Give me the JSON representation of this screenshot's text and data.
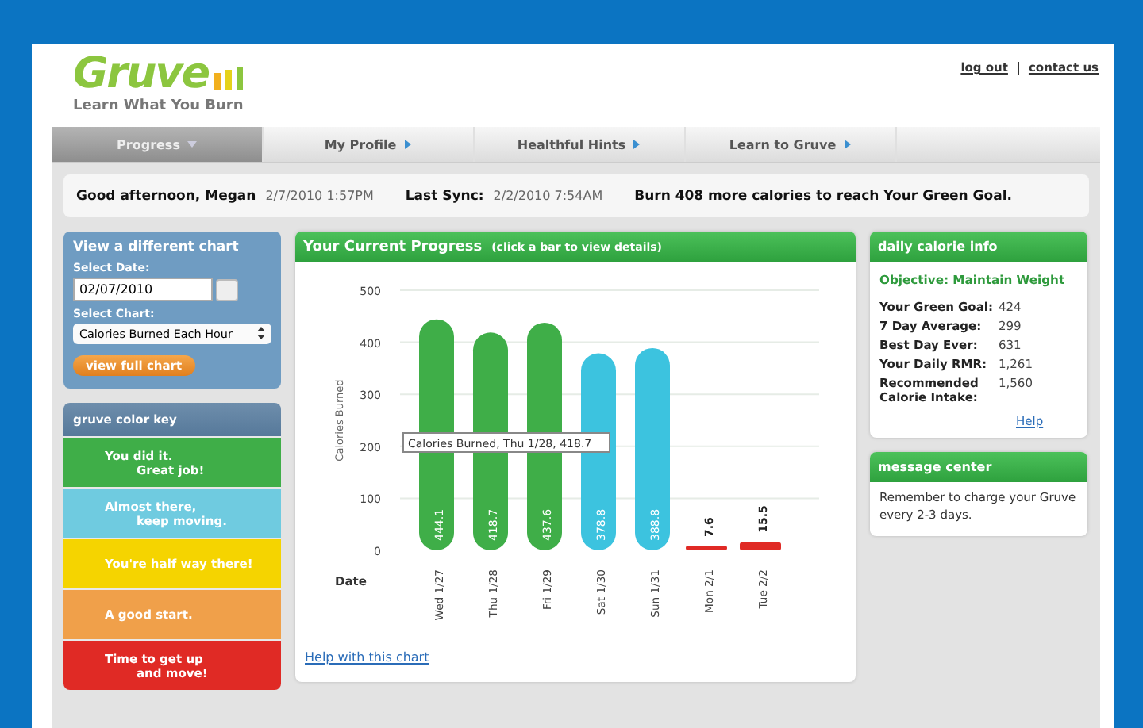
{
  "header": {
    "logo": "Gruve",
    "tagline": "Learn What You Burn",
    "links": [
      "log out",
      "contact us"
    ]
  },
  "nav": [
    {
      "label": "Progress",
      "selected": true
    },
    {
      "label": "My Profile",
      "selected": false
    },
    {
      "label": "Healthful Hints",
      "selected": false
    },
    {
      "label": "Learn to Gruve",
      "selected": false
    }
  ],
  "greeting": {
    "text": "Good afternoon, Megan",
    "datetime": "2/7/2010 1:57PM",
    "sync_label": "Last Sync:",
    "sync_time": "2/2/2010 7:54AM",
    "goal_message": "Burn 408 more calories to reach Your Green Goal."
  },
  "chart_picker": {
    "title": "View a different chart",
    "date_label": "Select Date:",
    "date_value": "02/07/2010",
    "chart_label": "Select Chart:",
    "chart_value": "Calories Burned Each Hour",
    "button": "view full chart"
  },
  "color_key": {
    "title": "gruve color key",
    "items": [
      {
        "lines": [
          "You did it.",
          "Great job!"
        ],
        "color": "#3fae48"
      },
      {
        "lines": [
          "Almost there,",
          "keep moving."
        ],
        "color": "#6fcbe0"
      },
      {
        "lines": [
          "You're half way there!"
        ],
        "color": "#f5d400"
      },
      {
        "lines": [
          "A good start."
        ],
        "color": "#f0a04a"
      },
      {
        "lines": [
          "Time to get up",
          "and move!"
        ],
        "color": "#e02a25"
      }
    ]
  },
  "progress": {
    "title": "Your Current Progress",
    "hint": "(click a bar to view details)",
    "help_link": "Help with this chart",
    "chart_data": {
      "type": "bar",
      "xlabel": "Date",
      "ylabel": "Calories Burned",
      "categories": [
        "Wed 1/27",
        "Thu 1/28",
        "Fri 1/29",
        "Sat 1/30",
        "Sun 1/31",
        "Mon 2/1",
        "Tue 2/2"
      ],
      "series": [
        {
          "color": "#3fae48",
          "values": [
            444.1,
            418.7,
            437.6,
            null,
            null,
            null,
            null
          ]
        },
        {
          "color": "#3cc3df",
          "values": [
            null,
            null,
            null,
            378.8,
            388.8,
            null,
            null
          ]
        },
        {
          "color": "#e02a25",
          "values": [
            null,
            null,
            null,
            null,
            null,
            7.6,
            15.5
          ]
        }
      ],
      "stacked": true,
      "grid": true,
      "ylim": [
        0,
        500
      ],
      "yticks": [
        0,
        100,
        200,
        300,
        400,
        500
      ],
      "value_labels": [
        "444.1",
        "418.7",
        "437.6",
        "378.8",
        "388.8",
        "7.6",
        "15.5"
      ],
      "annotations": [
        {
          "text": "Calories Burned, Thu 1/28, 418.7"
        }
      ]
    }
  },
  "calorie_info": {
    "title": "daily calorie info",
    "objective": "Objective: Maintain Weight",
    "rows": [
      {
        "label": "Your Green Goal:",
        "value": "424"
      },
      {
        "label": "7 Day Average:",
        "value": "299"
      },
      {
        "label": "Best Day Ever:",
        "value": "631"
      },
      {
        "label": "Your Daily RMR:",
        "value": "1,261"
      },
      {
        "label": "Recommended Calorie Intake:",
        "value": "1,560"
      }
    ],
    "help": "Help"
  },
  "message_center": {
    "title": "message center",
    "message": "Remember to charge your Gruve every 2-3 days."
  }
}
